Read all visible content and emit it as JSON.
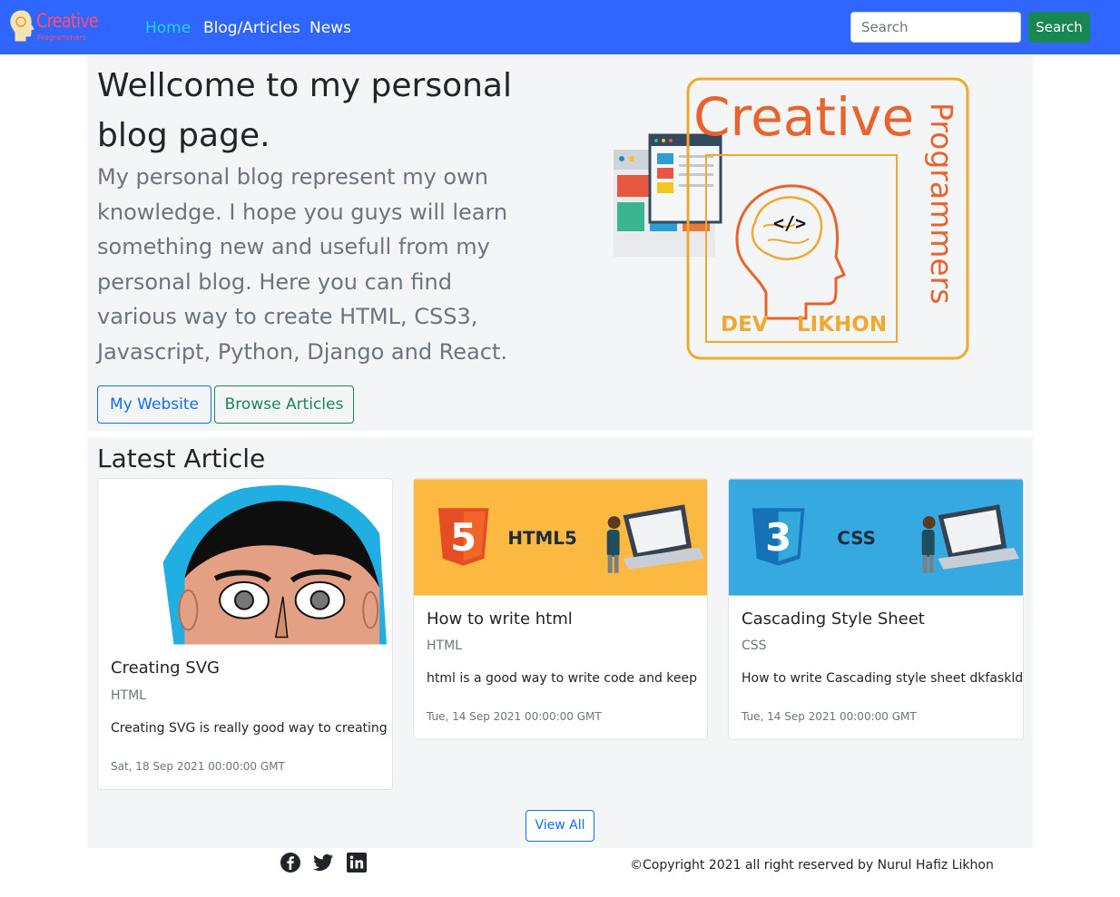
{
  "navbar": {
    "brand_text": "Creative",
    "brand_sub": "Programmers",
    "links": [
      "Home",
      "Blog/Articles",
      "News"
    ],
    "search_placeholder": "Search",
    "search_button": "Search",
    "bg_color": "#2f66ff",
    "active_color": "#22d3ee"
  },
  "hero": {
    "title": "Wellcome to my personal blog page.",
    "lead": "My personal blog represent my own knowledge. I hope you guys will learn something new and usefull from my personal blog. Here you can find various way to create HTML, CSS3, Javascript, Python, Django and React.",
    "btn_website": "My Website",
    "btn_browse": "Browse Articles",
    "logo": {
      "word_main": "Creative",
      "word_side": "Programmers",
      "dev": "DEV",
      "likhon": "LIKHON",
      "code": "</>"
    }
  },
  "latest": {
    "heading": "Latest Article",
    "cards": [
      {
        "title": "Creating SVG",
        "category": "HTML",
        "text": "Creating SVG is really good way to creating",
        "date": "Sat, 18 Sep 2021 00:00:00 GMT"
      },
      {
        "title": "How to write html",
        "category": "HTML",
        "text": "html is a good way to write code and keep",
        "date": "Tue, 14 Sep 2021 00:00:00 GMT",
        "banner_label": "HTML5",
        "banner_color": "#fbb941"
      },
      {
        "title": "Cascading Style Sheet",
        "category": "CSS",
        "text": "How to write Cascading style sheet dkfaskld",
        "date": "Tue, 14 Sep 2021 00:00:00 GMT",
        "banner_label": "CSS",
        "banner_color": "#36a9e1"
      }
    ],
    "view_all": "View All"
  },
  "footer": {
    "social_icons": [
      "facebook-icon",
      "twitter-icon",
      "linkedin-icon"
    ],
    "copyright": "©Copyright 2021 all right reserved by Nurul Hafiz Likhon"
  }
}
